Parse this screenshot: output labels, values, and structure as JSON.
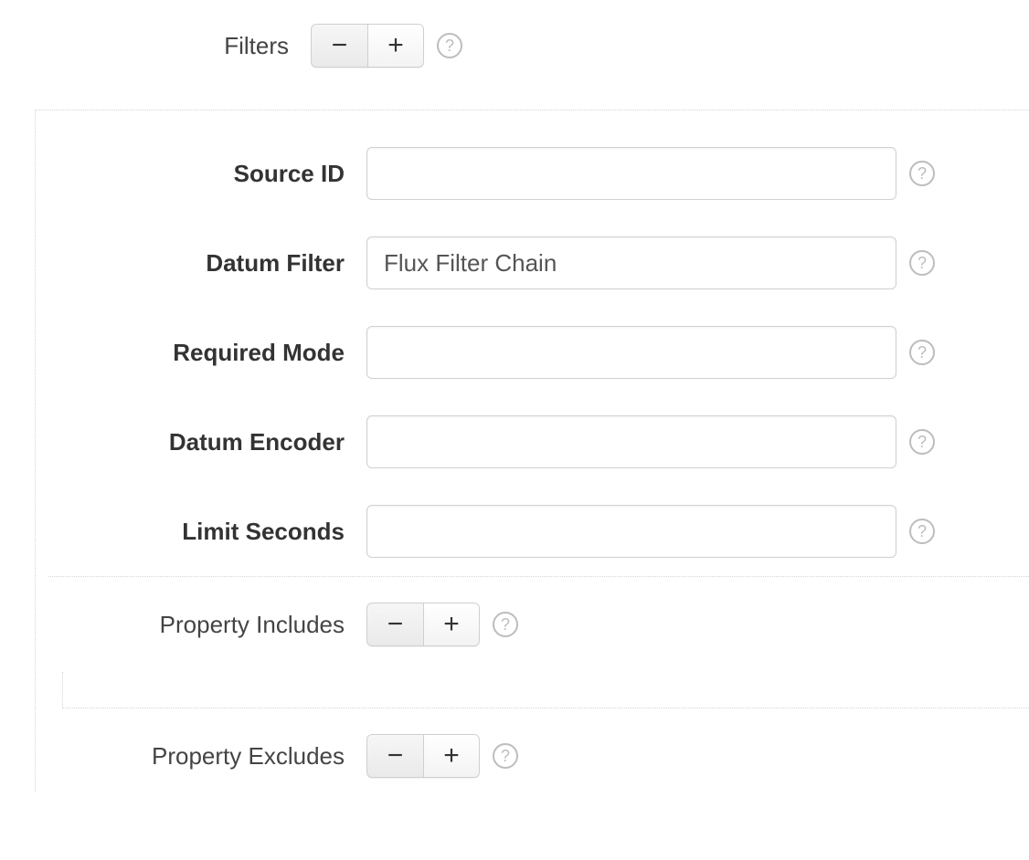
{
  "filters": {
    "label": "Filters",
    "minus": "−",
    "plus": "+",
    "help": "?"
  },
  "fields": {
    "source_id": {
      "label": "Source ID",
      "value": ""
    },
    "datum_filter": {
      "label": "Datum Filter",
      "value": "Flux Filter Chain"
    },
    "required_mode": {
      "label": "Required Mode",
      "value": ""
    },
    "datum_encoder": {
      "label": "Datum Encoder",
      "value": ""
    },
    "limit_seconds": {
      "label": "Limit Seconds",
      "value": ""
    }
  },
  "property_includes": {
    "label": "Property Includes",
    "minus": "−",
    "plus": "+",
    "help": "?"
  },
  "property_excludes": {
    "label": "Property Excludes",
    "minus": "−",
    "plus": "+",
    "help": "?"
  }
}
